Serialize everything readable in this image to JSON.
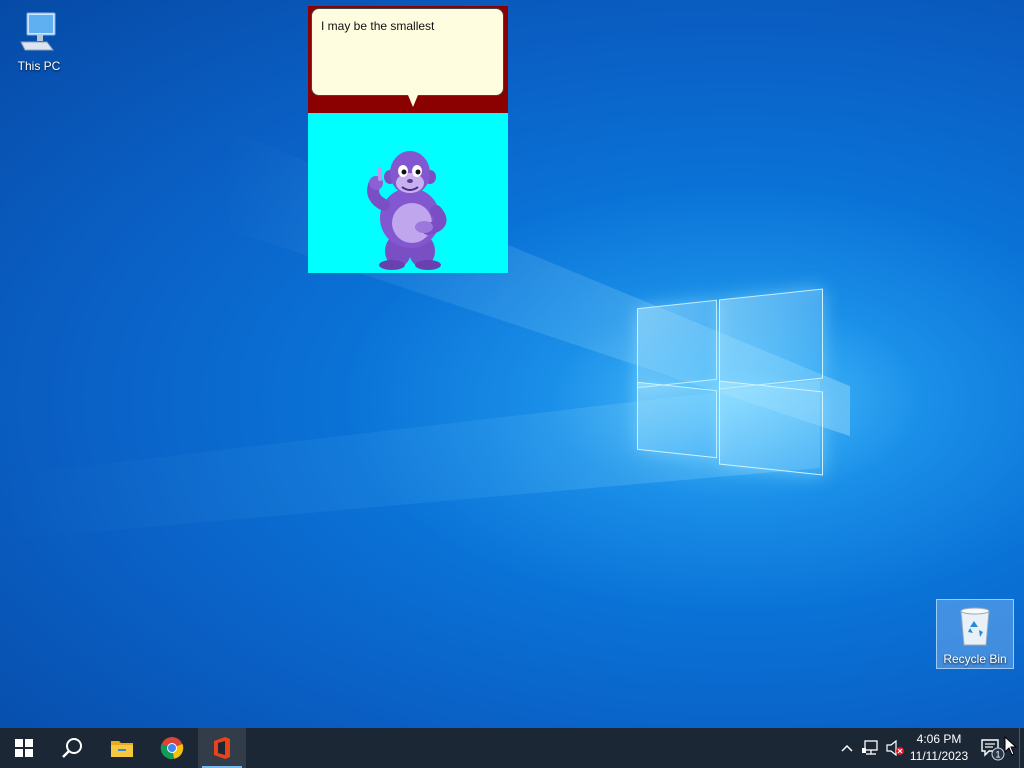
{
  "desktop": {
    "icons": [
      {
        "label": "This PC",
        "icon": "computer-icon"
      },
      {
        "label": "Recycle Bin",
        "icon": "recycle-bin-icon"
      }
    ]
  },
  "bonzi": {
    "speech": "I may be the smallest",
    "character": "purple-gorilla"
  },
  "taskbar": {
    "apps": [
      {
        "icon": "windows-start-icon"
      },
      {
        "icon": "search-icon"
      },
      {
        "icon": "file-explorer-icon"
      },
      {
        "icon": "chrome-icon"
      },
      {
        "icon": "office-icon",
        "active": true
      }
    ],
    "clock": {
      "time": "4:06 PM",
      "date": "11/11/2023"
    },
    "notification_count": "1"
  },
  "colors": {
    "speech_background": "#fffde0",
    "bonzi_header": "#8b0000",
    "bonzi_stage": "#00ffff",
    "taskbar": "#1c2736"
  }
}
